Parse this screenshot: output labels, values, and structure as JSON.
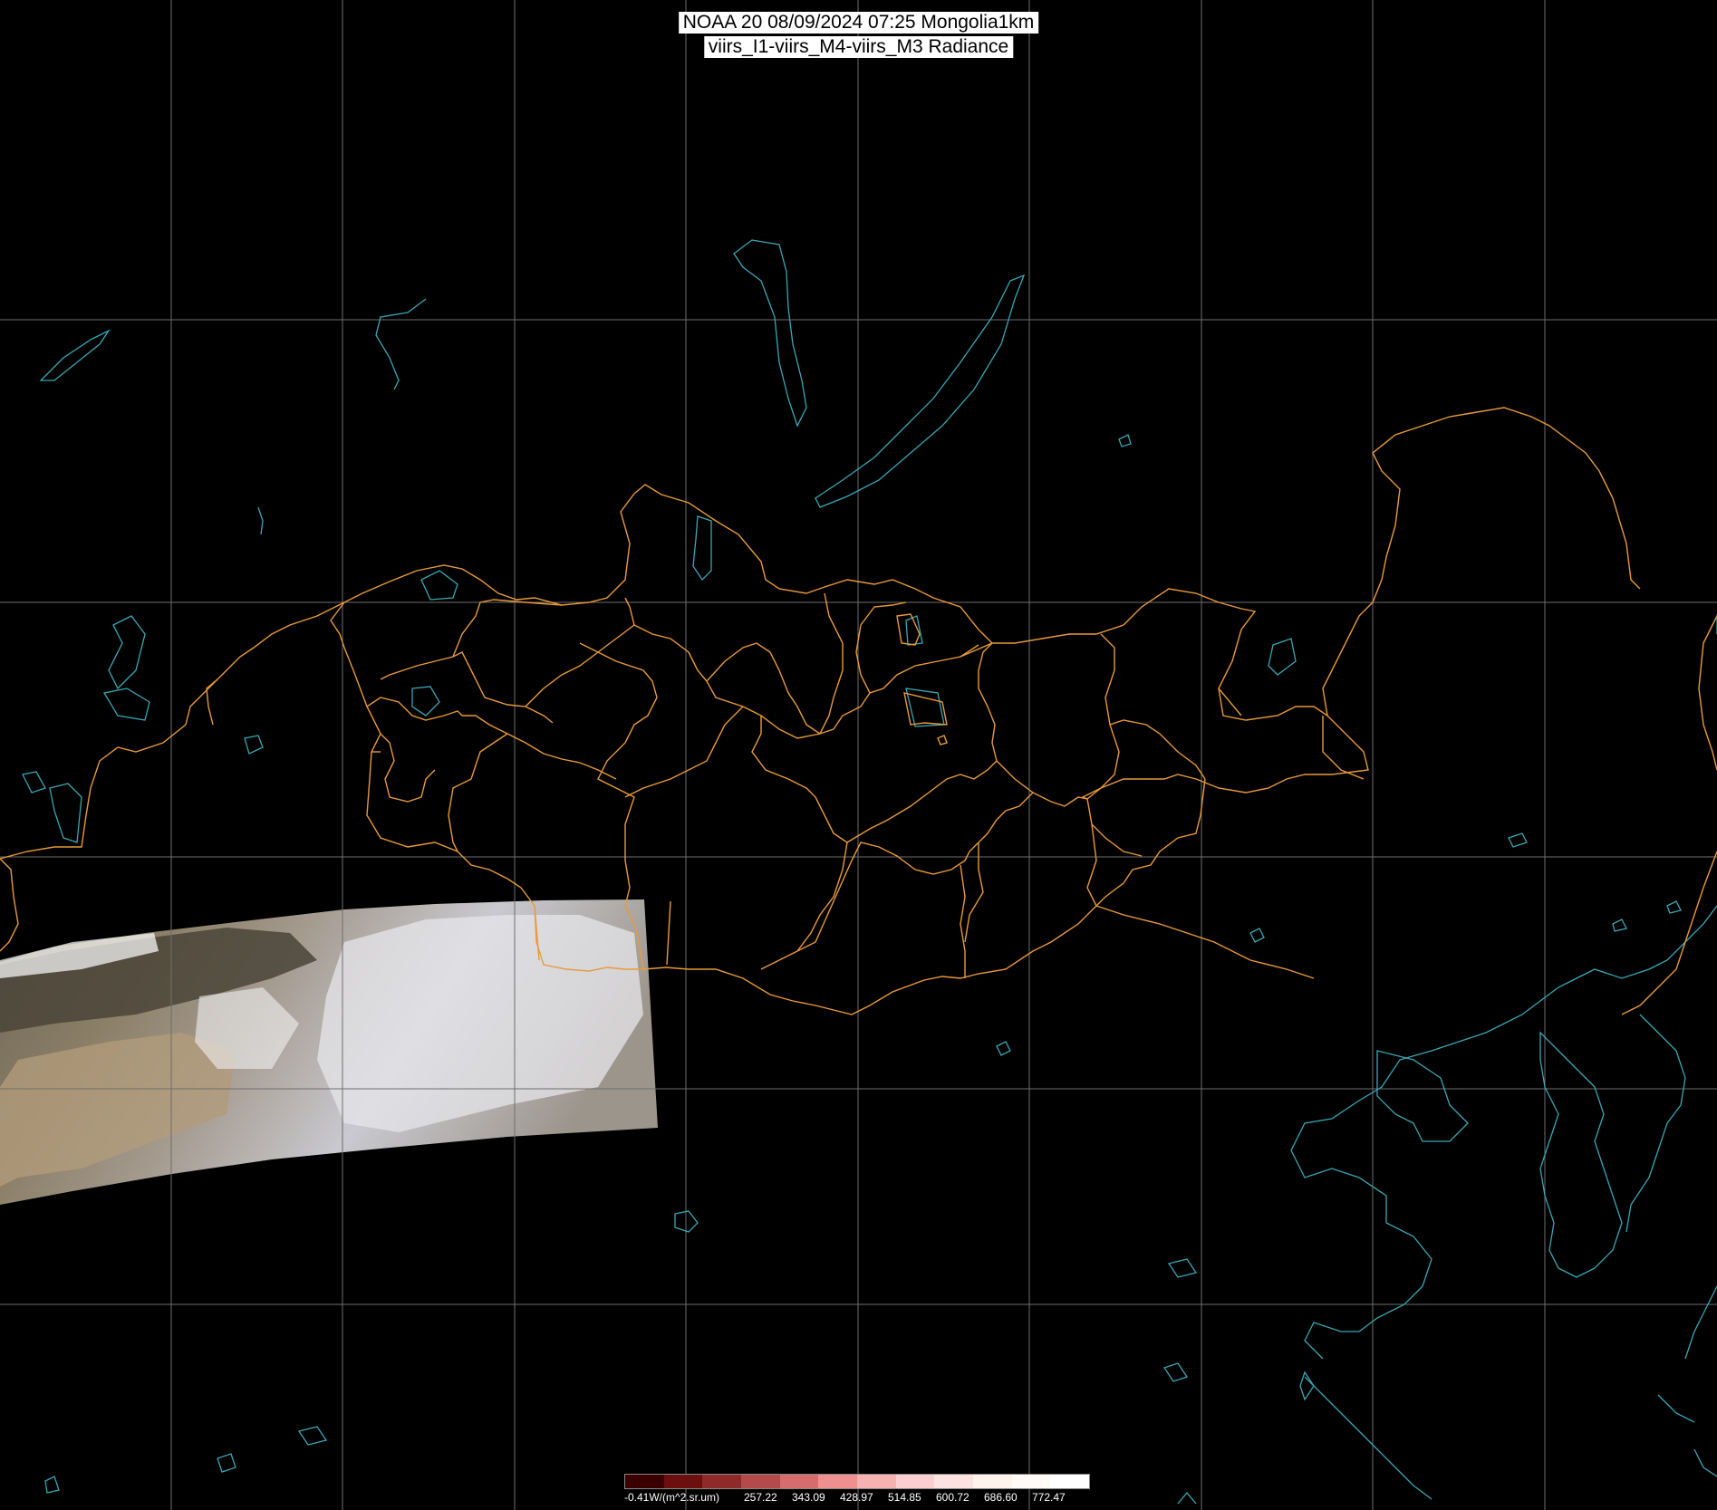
{
  "title": {
    "line1": "NOAA 20 08/09/2024 07:25 Mongolia1km",
    "line2": "viirs_I1-viirs_M4-viirs_M3 Radiance"
  },
  "colors": {
    "background": "#000000",
    "grid": "#6e6e6e",
    "boundaries": "#e89a3c",
    "coastline": "#3aa7b6"
  },
  "legend": {
    "unit_label": "-0.41W/(m^2.sr.um)",
    "tick_labels": [
      "257.22",
      "343.09",
      "428.97",
      "514.85",
      "600.72",
      "686.60",
      "772.47"
    ],
    "swatches": [
      "#3a0000",
      "#6b0f0f",
      "#8f2a2a",
      "#b54a4a",
      "#d76c6c",
      "#ee9090",
      "#f6b1b1",
      "#fbcfcf",
      "#fde2e2",
      "#fff3ee",
      "#fffaf6",
      "#ffffff"
    ]
  }
}
